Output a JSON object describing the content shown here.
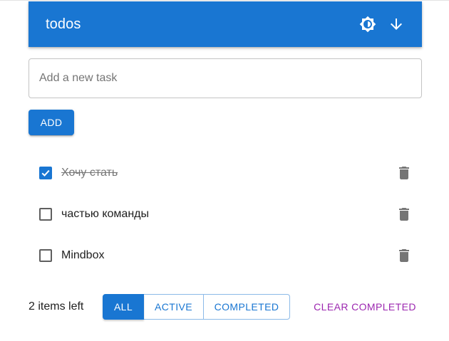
{
  "header": {
    "title": "todos",
    "theme_toggle_icon": "brightness-icon",
    "toggle_all_icon": "arrow-down-icon"
  },
  "new_task": {
    "placeholder": "Add a new task",
    "value": ""
  },
  "add_button": {
    "label": "ADD"
  },
  "tasks": [
    {
      "text": "Хочу стать",
      "completed": true,
      "delete_icon": "trash-icon"
    },
    {
      "text": "частью команды",
      "completed": false,
      "delete_icon": "trash-icon"
    },
    {
      "text": "Mindbox",
      "completed": false,
      "delete_icon": "trash-icon"
    }
  ],
  "footer": {
    "items_left": "2 items left",
    "filters": [
      {
        "label": "ALL",
        "selected": true
      },
      {
        "label": "ACTIVE",
        "selected": false
      },
      {
        "label": "COMPLETED",
        "selected": false
      }
    ],
    "clear_completed": "CLEAR COMPLETED"
  },
  "colors": {
    "primary": "#1976d2",
    "secondary": "#9c27b0",
    "icon_gray": "#757575"
  }
}
